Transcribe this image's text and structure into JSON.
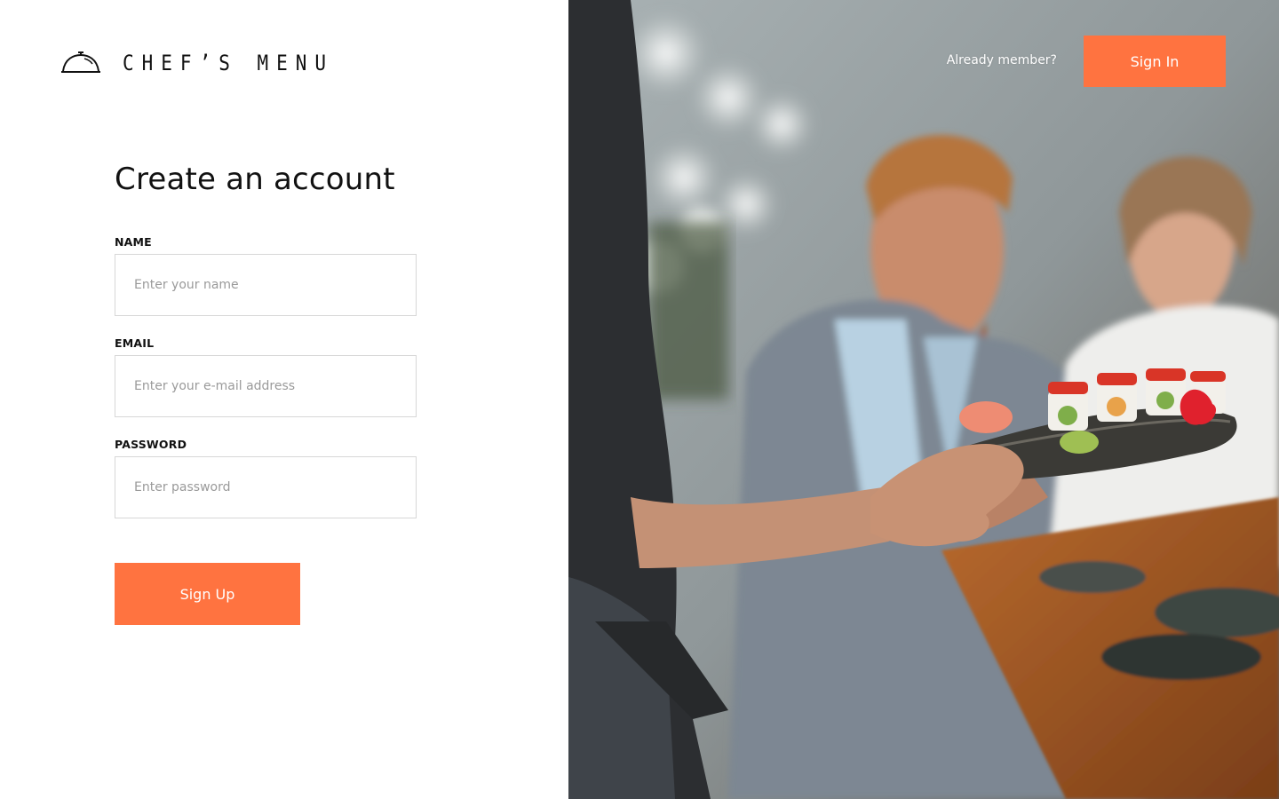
{
  "app": {
    "brand_name": "CHEF’S MENU",
    "logo_icon": "cloche-icon"
  },
  "form": {
    "title": "Create an account",
    "fields": [
      {
        "label": "NAME",
        "placeholder": "Enter your name",
        "value": ""
      },
      {
        "label": "EMAIL",
        "placeholder": "Enter your e-mail address",
        "value": ""
      },
      {
        "label": "PASSWORD",
        "placeholder": "Enter password",
        "value": ""
      }
    ],
    "submit_label": "Sign Up"
  },
  "header": {
    "prompt": "Already member?",
    "signin_label": "Sign In"
  },
  "colors": {
    "accent": "#ff7340",
    "border": "#d7d7d7",
    "placeholder": "#9a9a9a"
  },
  "hero": {
    "image_icon": "restaurant-photo"
  }
}
